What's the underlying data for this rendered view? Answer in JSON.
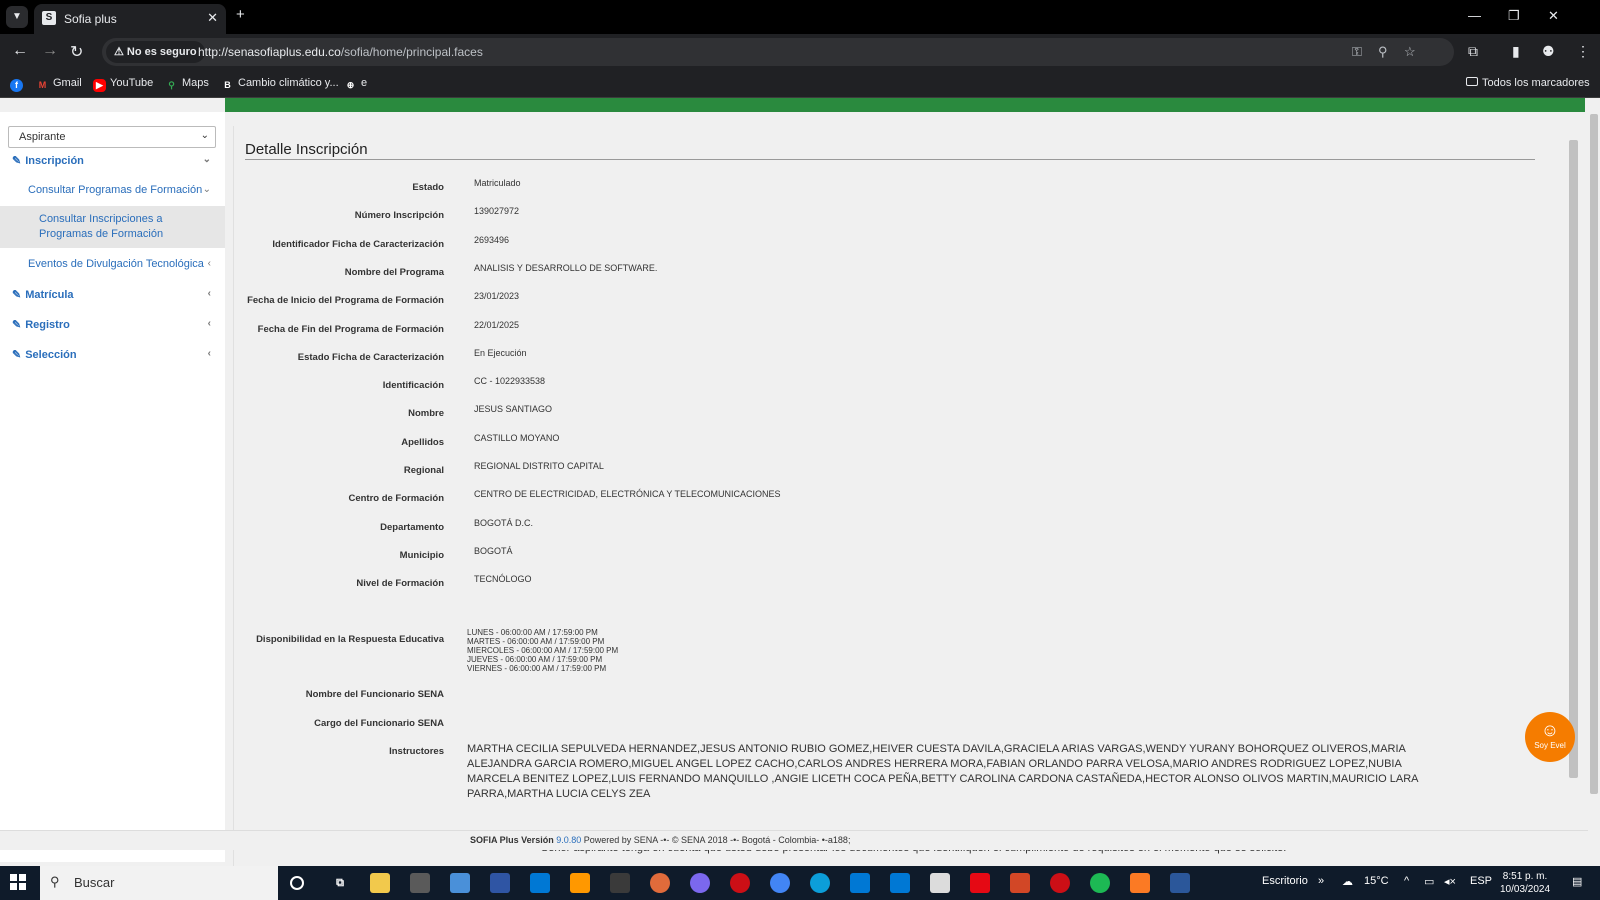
{
  "browser": {
    "tab_title": "Sofia plus",
    "tab_favicon": "S",
    "new_tab": "+",
    "security_label": "No es seguro",
    "url_host": "http://senasofiaplus.edu.co",
    "url_path": "/sofia/home/principal.faces",
    "bookmarks": [
      {
        "label": "",
        "icon": "facebook-icon",
        "color": "#1877f2"
      },
      {
        "label": "Gmail",
        "icon": "gmail-icon",
        "color": "#ea4335"
      },
      {
        "label": "YouTube",
        "icon": "youtube-icon",
        "color": "#ff0000"
      },
      {
        "label": "Maps",
        "icon": "maps-icon",
        "color": "#34a853"
      },
      {
        "label": "Cambio climático y...",
        "icon": "bing-icon",
        "color": "#ffffff"
      },
      {
        "label": "e",
        "icon": "globe-icon",
        "color": "#ffffff"
      }
    ],
    "all_bookmarks": "Todos los marcadores"
  },
  "sidebar": {
    "role": "Aspirante",
    "items": [
      {
        "label": "Inscripción",
        "level": 1
      },
      {
        "label": "Consultar Programas de Formación",
        "level": 2
      },
      {
        "label": "Consultar Inscripciones a Programas de Formación",
        "level": 3
      },
      {
        "label": "Eventos de Divulgación Tecnológica",
        "level": 2
      },
      {
        "label": "Matrícula",
        "level": 1
      },
      {
        "label": "Registro",
        "level": 1
      },
      {
        "label": "Selección",
        "level": 1
      }
    ]
  },
  "detail": {
    "title": "Detalle Inscripción",
    "fields": [
      {
        "label": "Estado",
        "value": "Matriculado"
      },
      {
        "label": "Número Inscripción",
        "value": "139027972"
      },
      {
        "label": "Identificador Ficha de Caracterización",
        "value": "2693496"
      },
      {
        "label": "Nombre del Programa",
        "value": "ANALISIS Y DESARROLLO DE SOFTWARE."
      },
      {
        "label": "Fecha de Inicio del Programa de Formación",
        "value": "23/01/2023"
      },
      {
        "label": "Fecha de Fin del Programa de Formación",
        "value": "22/01/2025"
      },
      {
        "label": "Estado Ficha de Caracterización",
        "value": "En Ejecución"
      },
      {
        "label": "Identificación",
        "value": "CC - 1022933538"
      },
      {
        "label": "Nombre",
        "value": "JESUS SANTIAGO"
      },
      {
        "label": "Apellidos",
        "value": "CASTILLO MOYANO"
      },
      {
        "label": "Regional",
        "value": "REGIONAL DISTRITO CAPITAL"
      },
      {
        "label": "Centro de Formación",
        "value": "CENTRO DE ELECTRICIDAD, ELECTRÓNICA Y TELECOMUNICACIONES"
      },
      {
        "label": "Departamento",
        "value": "BOGOTÁ D.C."
      },
      {
        "label": "Municipio",
        "value": "BOGOTÁ"
      },
      {
        "label": "Nivel de Formación",
        "value": "TECNÓLOGO"
      }
    ],
    "availability_label": "Disponibilidad en la Respuesta Educativa",
    "availability": [
      "LUNES - 06:00:00 AM / 17:59:00 PM",
      "MARTES - 06:00:00 AM / 17:59:00 PM",
      "MIERCOLES - 06:00:00 AM / 17:59:00 PM",
      "JUEVES - 06:00:00 AM / 17:59:00 PM",
      "VIERNES - 06:00:00 AM / 17:59:00 PM"
    ],
    "funcionario_nombre_label": "Nombre del Funcionario SENA",
    "funcionario_cargo_label": "Cargo del Funcionario SENA",
    "instructores_label": "Instructores",
    "instructores": "MARTHA CECILIA SEPULVEDA HERNANDEZ,JESUS ANTONIO RUBIO GOMEZ,HEIVER CUESTA DAVILA,GRACIELA ARIAS VARGAS,WENDY YURANY BOHORQUEZ OLIVEROS,MARIA ALEJANDRA GARCIA ROMERO,MIGUEL ANGEL LOPEZ CACHO,CARLOS ANDRES HERRERA MORA,FABIAN ORLANDO PARRA VELOSA,MARIO ANDRES RODRIGUEZ LOPEZ,NUBIA MARCELA BENITEZ LOPEZ,LUIS FERNANDO MANQUILLO ,ANGIE LICETH COCA PEÑA,BETTY CAROLINA CARDONA CASTAÑEDA,HECTOR ALONSO OLIVOS MARTIN,MAURICIO LARA PARRA,MARTHA LUCIA CELYS ZEA",
    "notice": "Señor aspirante tenga en cuenta que usted debe presentar los documentos que identifiquen el cumplimiento de requisitos en el momento que se solicite."
  },
  "footer": {
    "prefix": "SOFIA Plus Versión ",
    "version": "9.0.80",
    "suffix": " Powered by SENA -•- © SENA 2018 -•- Bogotá - Colombia- •-a188;"
  },
  "bot_label": "Soy Evel",
  "taskbar": {
    "search_placeholder": "Buscar",
    "desktop_label": "Escritorio",
    "weather": "15°C",
    "lang": "ESP",
    "time": "8:51 p. m.",
    "date": "10/03/2024"
  }
}
